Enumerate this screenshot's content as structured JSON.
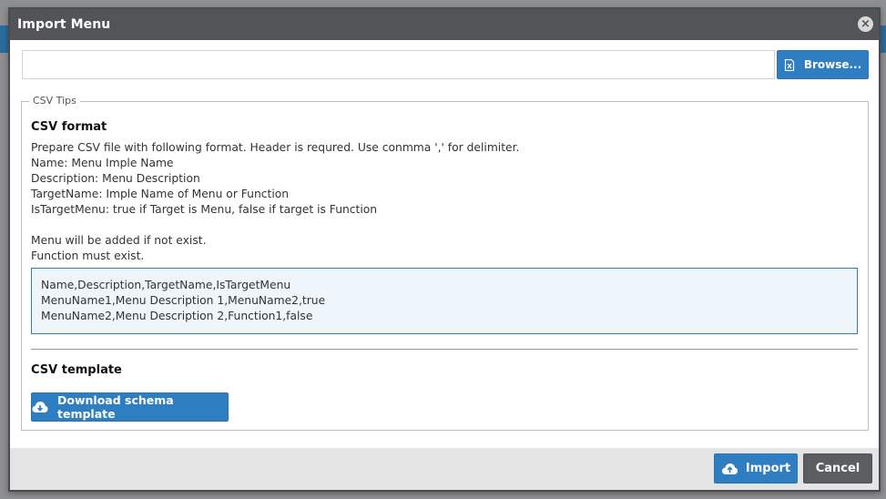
{
  "dialog": {
    "title": "Import Menu",
    "close_icon": "close-circle-icon"
  },
  "file": {
    "value": "",
    "browse_label": "Browse...",
    "browse_icon": "excel-file-icon"
  },
  "tips": {
    "legend": "CSV Tips",
    "format_heading": "CSV format",
    "lines": [
      "Prepare CSV file with following format. Header is requred. Use conmma ',' for delimiter.",
      "Name: Menu Imple Name",
      "Description: Menu Description",
      "TargetName: Imple Name of Menu or Function",
      "IsTargetMenu: true if Target is Menu, false if target is Function",
      "",
      "Menu will be added if not exist.",
      "Function must exist."
    ],
    "example_lines": [
      "Name,Description,TargetName,IsTargetMenu",
      "MenuName1,Menu Description 1,MenuName2,true",
      "MenuName2,Menu Description 2,Function1,false"
    ],
    "template_heading": "CSV template",
    "download_label": "Download schema template",
    "download_icon": "cloud-download-icon"
  },
  "footer": {
    "import_label": "Import",
    "import_icon": "cloud-upload-icon",
    "cancel_label": "Cancel"
  },
  "colors": {
    "primary": "#2f7ec1",
    "header": "#535458",
    "cancel": "#5c5d61",
    "code_bg": "#eef5fb"
  }
}
